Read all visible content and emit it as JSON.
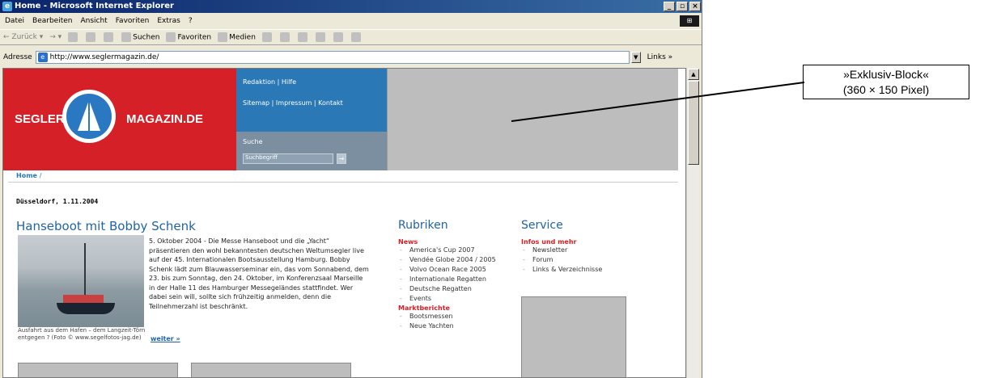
{
  "window": {
    "title": "Home - Microsoft Internet Explorer",
    "controls": [
      "_",
      "у",
      "x"
    ]
  },
  "menubar": [
    "Datei",
    "Bearbeiten",
    "Ansicht",
    "Favoriten",
    "Extras",
    "?"
  ],
  "toolbar": {
    "back": "Zurück",
    "search": "Suchen",
    "favorites": "Favoriten",
    "media": "Medien"
  },
  "addressbar": {
    "label": "Adresse",
    "url": "http://www.seglermagazin.de/",
    "links": "Links"
  },
  "site": {
    "logo_left": "SEGLER",
    "logo_right": "MAGAZIN.DE",
    "nav_links": [
      "Redaktion | Hilfe",
      "Sitemap | Impressum | Kontakt"
    ],
    "search_label": "Suche",
    "search_placeholder": "Suchbegriff",
    "search_go": "→",
    "breadcrumb": "Home",
    "breadcrumb_sep": "/",
    "date": "Düsseldorf, 1.11.2004",
    "article": {
      "title": "Hanseboot mit Bobby Schenk",
      "body": "5. Oktober 2004 - Die Messe Hanseboot und die „Yacht“ präsentieren den wohl bekanntesten deutschen Weltumsegler live auf der 45. Internationalen Bootsausstellung Hamburg. Bobby Schenk lädt zum Blauwasserseminar ein, das vom Sonnabend, dem 23. bis zum Sonntag, den 24. Oktober, im Konferenzsaal Marseille in der Halle 11 des Hamburger Messegeländes stattfindet. Wer dabei sein will, sollte sich frühzeitig anmelden, denn die Teilnehmerzahl ist beschränkt.",
      "read_more": "weiter »",
      "photo_caption": "Ausfahrt aus dem Hafen – dem Langzeit-Törn entgegen ? (Foto © www.segelfotos-jag.de)"
    },
    "rubriken": {
      "title": "Rubriken",
      "news_head": "News",
      "news_items": [
        "America's Cup 2007",
        "Vendée Globe 2004 / 2005",
        "Volvo Ocean Race 2005",
        "Internationale Regatten",
        "Deutsche Regatten",
        "Events"
      ],
      "markt_head": "Marktberichte",
      "markt_items": [
        "Bootsmessen",
        "Neue Yachten"
      ]
    },
    "service": {
      "title": "Service",
      "head": "Infos und mehr",
      "items": [
        "Newsletter",
        "Forum",
        "Links & Verzeichnisse"
      ]
    }
  },
  "annotation": {
    "line1": "»Exklusiv-Block«",
    "line2": "(360 × 150 Pixel)"
  },
  "colors": {
    "brand_red": "#d62027",
    "brand_blue": "#2a78b5",
    "placeholder_gray": "#bdbdbd"
  }
}
